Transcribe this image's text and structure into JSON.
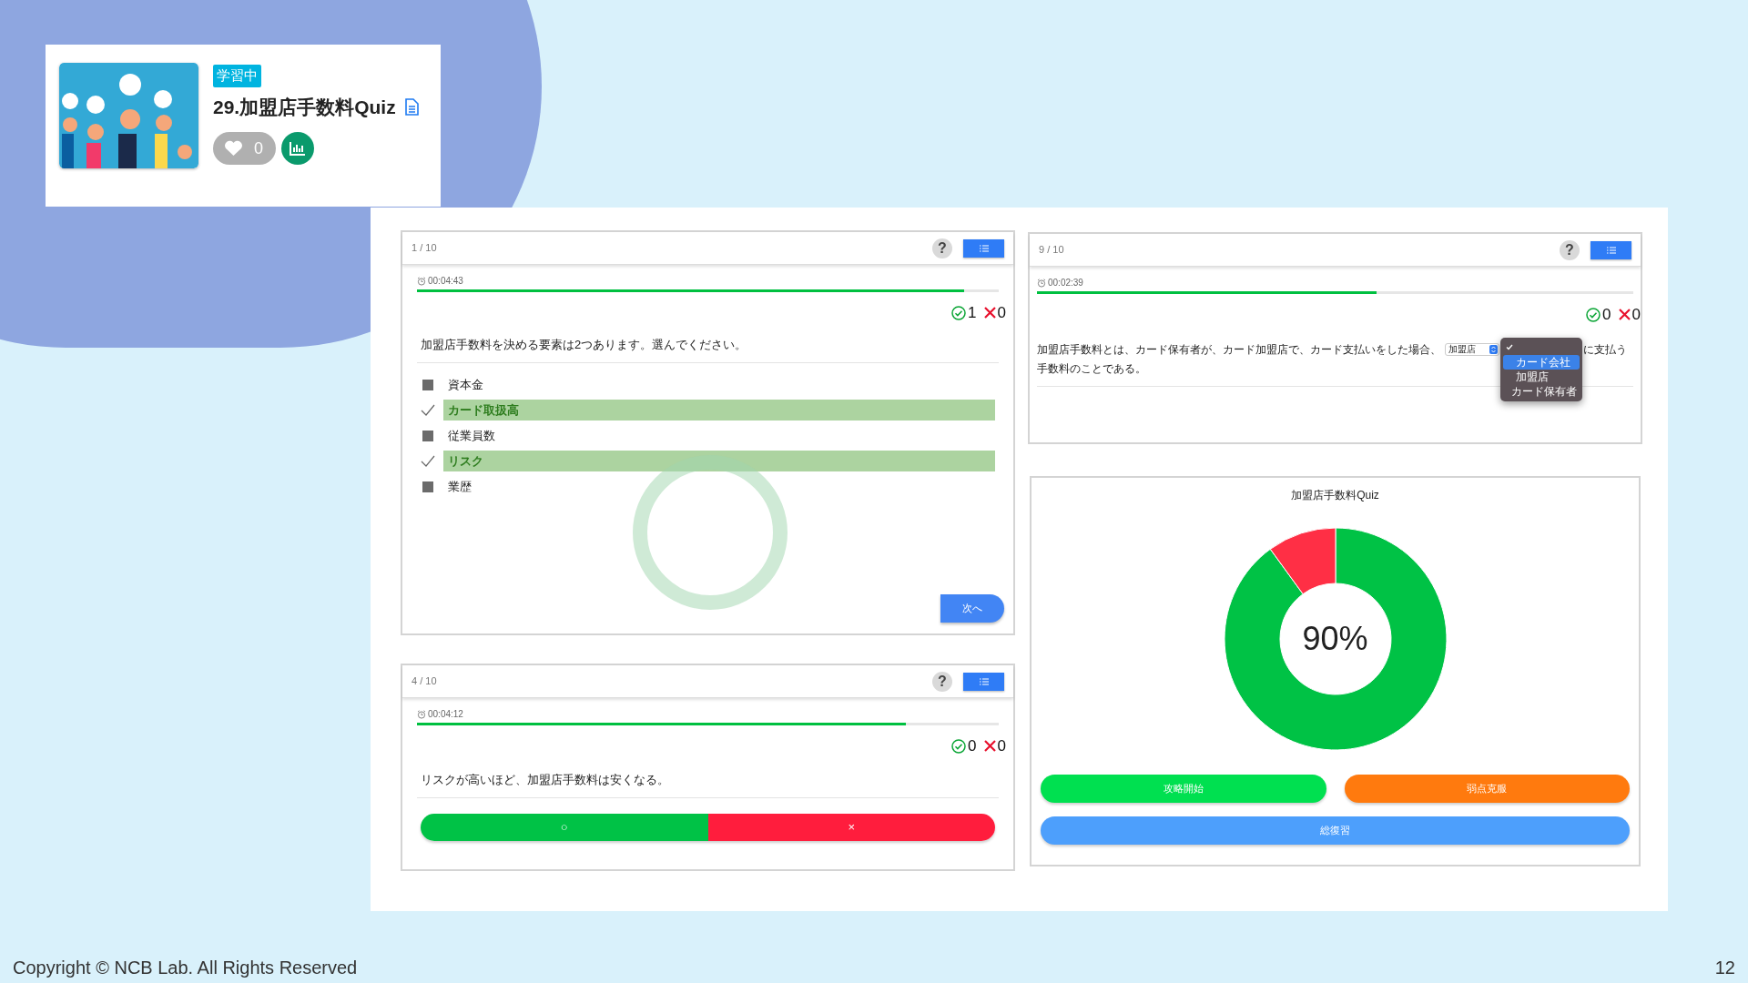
{
  "card": {
    "badge": "学習中",
    "title": "29.加盟店手数料Quiz",
    "liked": false,
    "likes": "0"
  },
  "left_panels": [
    {
      "kind": "choice",
      "counter": "1 / 10",
      "help": "?",
      "timer": "00:04:43",
      "level": 0.94,
      "correct": "1",
      "wrong": "0",
      "question": "加盟店手数料を決める要素は2つあります。選んでください。",
      "options": [
        {
          "label": "資本金",
          "checked": false
        },
        {
          "label": "カード取扱高",
          "checked": true
        },
        {
          "label": "従業員数",
          "checked": false
        },
        {
          "label": "リスク",
          "checked": true
        },
        {
          "label": "業歴",
          "checked": false
        }
      ],
      "next_button": "次へ"
    },
    {
      "kind": "true_false",
      "counter": "4 / 10",
      "help": "?",
      "timer": "00:04:12",
      "level": 0.84,
      "correct": "0",
      "wrong": "0",
      "question": "リスクが高いほど、加盟店手数料は安くなる。",
      "true_button": "○",
      "false_button": "×"
    }
  ],
  "right_panels": [
    {
      "kind": "fill_blank",
      "counter": "9 / 10",
      "help": "?",
      "timer": "00:02:39",
      "level": 0.57,
      "correct": "0",
      "wrong": "0",
      "question_before": "加盟店手数料とは、カード保有者が、カード加盟店で、カード支払いをした場合、",
      "select_value": "加盟店",
      "question_after": "に支払う",
      "question_line2": "手数料のことである。",
      "dropdown": [
        {
          "checked": true,
          "selected": false
        },
        {
          "label": "カード会社",
          "checked": false,
          "selected": true
        },
        {
          "label": "加盟店",
          "checked": false,
          "selected": false
        },
        {
          "label": "カード保有者",
          "checked": false,
          "selected": false
        }
      ]
    },
    {
      "kind": "result",
      "title": "加盟店手数料Quiz",
      "chart_data": {
        "type": "donut",
        "values": [
          90,
          10
        ]
      },
      "center_label": "90%",
      "buttons": [
        {
          "label": "攻略開始",
          "kind": "start"
        },
        {
          "label": "弱点克服",
          "kind": "weak"
        },
        {
          "label": "総復習",
          "kind": "review"
        }
      ]
    }
  ],
  "footer": {
    "copyright": "Copyright © NCB Lab. All Rights Reserved",
    "page": "12"
  }
}
